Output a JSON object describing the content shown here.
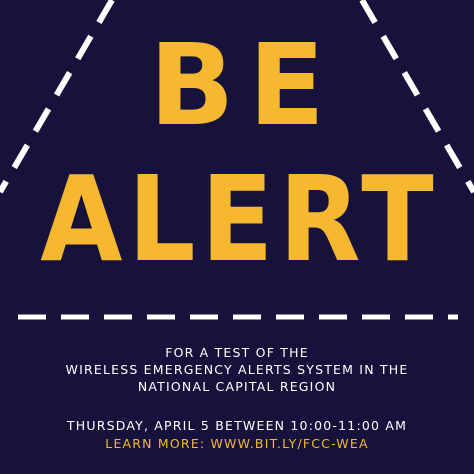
{
  "headline": {
    "line1": "BE",
    "line2": "ALERT"
  },
  "info": {
    "line1": "FOR A TEST OF THE",
    "line2": "WIRELESS EMERGENCY ALERTS SYSTEM IN THE",
    "line3": "NATIONAL CAPITAL REGION"
  },
  "event": {
    "datetime": "THURSDAY, APRIL 5 BETWEEN 10:00-11:00 AM"
  },
  "link": {
    "text": "LEARN MORE: WWW.BIT.LY/FCC-WEA"
  },
  "colors": {
    "background": "#17123b",
    "accent": "#f5b82e",
    "text": "#ffffff",
    "dashes": "#ffffff"
  }
}
